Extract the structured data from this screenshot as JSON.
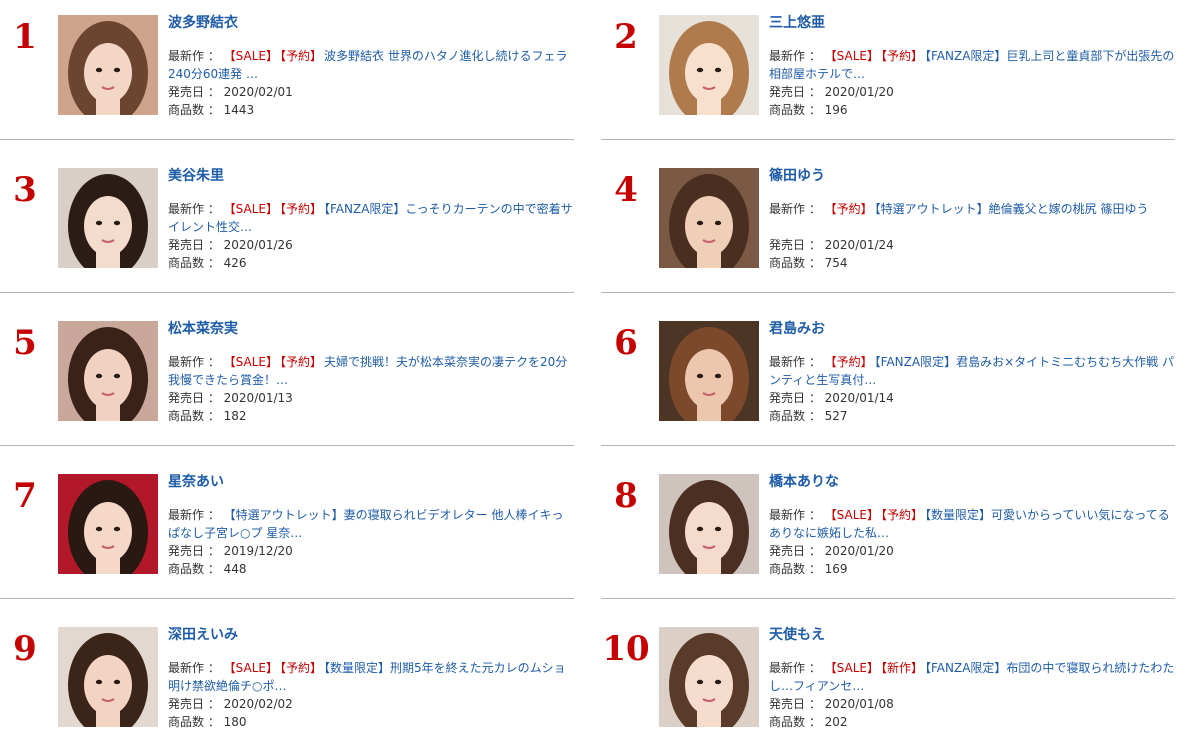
{
  "labels": {
    "latest": "最新作 ：",
    "release_date": "発売日 ：",
    "product_count": "商品数 ："
  },
  "colors": {
    "rank_number": "#c40000",
    "name_link": "#1f5ca8",
    "sale_tag": "#c40000",
    "title_link": "#1f5ca8",
    "divider": "#b3b3b3"
  },
  "ranking": [
    {
      "rank": "1",
      "name": "波多野結衣",
      "tags": [
        "【SALE】",
        "【予約】"
      ],
      "promo_tags": [],
      "title": "波多野結衣 世界のハタノ進化し続けるフェラ240分60連発 …",
      "release_date": "2020/02/01",
      "product_count": "1443",
      "photo": {
        "bg": "#cfa48d",
        "hair": "#6b4530",
        "skin": "#f3d6c4"
      }
    },
    {
      "rank": "2",
      "name": "三上悠亜",
      "tags": [
        "【SALE】",
        "【予約】"
      ],
      "promo_tags": [],
      "title": "【FANZA限定】巨乳上司と童貞部下が出張先の相部屋ホテルで…",
      "release_date": "2020/01/20",
      "product_count": "196",
      "photo": {
        "bg": "#e6e2da",
        "hair": "#b07b4c",
        "skin": "#f8e0cf"
      }
    },
    {
      "rank": "3",
      "name": "美谷朱里",
      "tags": [
        "【SALE】",
        "【予約】"
      ],
      "promo_tags": [],
      "title": "【FANZA限定】こっそりカーテンの中で密着サイレント性交…",
      "release_date": "2020/01/26",
      "product_count": "426",
      "photo": {
        "bg": "#d9cfc6",
        "hair": "#2b1c16",
        "skin": "#f4dccd"
      }
    },
    {
      "rank": "4",
      "name": "篠田ゆう",
      "tags": [
        "【予約】"
      ],
      "promo_tags": [],
      "title": "【特選アウトレット】絶倫義父と嫁の桃尻 篠田ゆう",
      "release_date": "2020/01/24",
      "product_count": "754",
      "photo": {
        "bg": "#7a5a44",
        "hair": "#4a2e1f",
        "skin": "#efcfb8"
      }
    },
    {
      "rank": "5",
      "name": "松本菜奈実",
      "tags": [
        "【SALE】",
        "【予約】"
      ],
      "promo_tags": [],
      "title": "夫婦で挑戦！夫が松本菜奈実の凄テクを20分我慢できたら賞金！…",
      "release_date": "2020/01/13",
      "product_count": "182",
      "photo": {
        "bg": "#c9a79a",
        "hair": "#3a2219",
        "skin": "#f1d2c2"
      }
    },
    {
      "rank": "6",
      "name": "君島みお",
      "tags": [
        "【予約】"
      ],
      "promo_tags": [],
      "title": "【FANZA限定】君島みお×タイトミニむちむち大作戦 パンティと生写真付…",
      "release_date": "2020/01/14",
      "product_count": "527",
      "photo": {
        "bg": "#4d3526",
        "hair": "#7c4a2b",
        "skin": "#ecc7ae"
      }
    },
    {
      "rank": "7",
      "name": "星奈あい",
      "tags": [],
      "promo_tags": [],
      "title": "【特選アウトレット】妻の寝取られビデオレター 他人棒イキっぱなし子宮レ○プ 星奈…",
      "release_date": "2019/12/20",
      "product_count": "448",
      "photo": {
        "bg": "#b3172a",
        "hair": "#2a1812",
        "skin": "#f5d8c8"
      }
    },
    {
      "rank": "8",
      "name": "橋本ありな",
      "tags": [
        "【SALE】",
        "【予約】"
      ],
      "promo_tags": [],
      "title": "【数量限定】可愛いからっていい気になってるありなに嫉妬した私…",
      "release_date": "2020/01/20",
      "product_count": "169",
      "photo": {
        "bg": "#cfc4bd",
        "hair": "#4a2f22",
        "skin": "#f5dbcc"
      }
    },
    {
      "rank": "9",
      "name": "深田えいみ",
      "tags": [
        "【SALE】",
        "【予約】"
      ],
      "promo_tags": [],
      "title": "【数量限定】刑期5年を終えた元カレのムショ明け禁欲絶倫チ○ポ…",
      "release_date": "2020/02/02",
      "product_count": "180",
      "photo": {
        "bg": "#e3d8cf",
        "hair": "#3b2418",
        "skin": "#f3d4c2"
      }
    },
    {
      "rank": "10",
      "name": "天使もえ",
      "tags": [
        "【SALE】",
        "【新作】"
      ],
      "promo_tags": [],
      "title": "【FANZA限定】布団の中で寝取られ続けたわたし…フィアンセ…",
      "release_date": "2020/01/08",
      "product_count": "202",
      "photo": {
        "bg": "#dcd0c6",
        "hair": "#5a3a28",
        "skin": "#f6dccd"
      }
    }
  ]
}
